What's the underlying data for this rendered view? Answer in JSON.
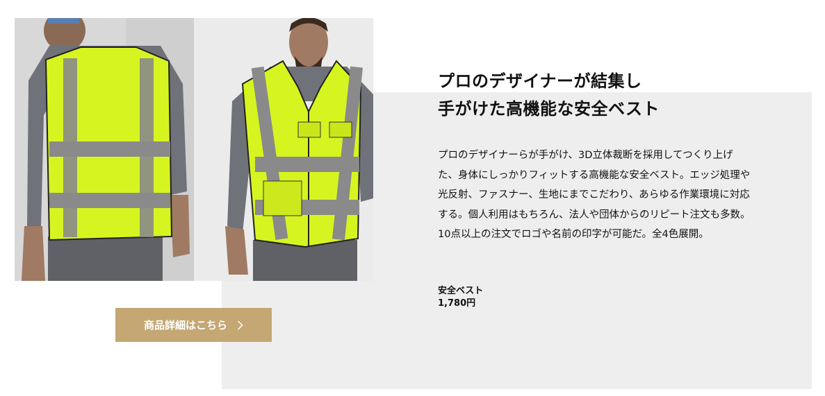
{
  "headline": {
    "line1": "プロのデザイナーが結集し",
    "line2": "手がけた高機能な安全ベスト"
  },
  "description": "プロのデザイナーらが手がけ、3D立体裁断を採用してつくり上げた、身体にしっかりフィットする高機能な安全ベスト。エッジ処理や光反射、ファスナー、生地にまでこだわり、あらゆる作業環境に対応する。個人利用はもちろん、法人や団体からのリピート注文も多数。10点以上の注文でロゴや名前の印字が可能だ。全4色展開。",
  "product": {
    "name": "安全ベスト",
    "price": "1,780円"
  },
  "cta": {
    "label": "商品詳細はこちら",
    "icon": "chevron-right-icon"
  },
  "colors": {
    "panel_bg": "#eeeeee",
    "button_bg": "#c4a773",
    "vest_yellow": "#d6f520",
    "reflective_stripe": "#8a8a8a",
    "shirt_gray": "#6f7278"
  }
}
